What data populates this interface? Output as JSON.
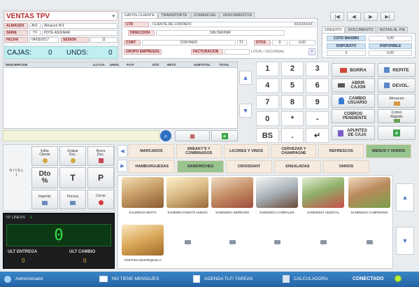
{
  "header": {
    "title": "VENTAS TPV",
    "almacen_label": "ALMACEN",
    "almacen_code": "A01",
    "almacen_name": "Almacen Nº1",
    "serie_label": "SERIE",
    "serie_code": "TV",
    "serie_name": "PDTE.ASIGNAR",
    "fecha_label": "FECHA",
    "fecha_value": "04/05/2017",
    "sesion_label": "SESION",
    "sesion_value": "11",
    "cajas_label": "CAJAS:",
    "cajas_value": "0",
    "unds_label": "UNDS:",
    "unds_value": "0"
  },
  "client_tabs": [
    "DATOS CLIENTE",
    "TRANSPORTE",
    "COMERCIAL",
    "VENCIMIENTOS"
  ],
  "client": {
    "ctd_label": "CTD",
    "ctd_value": "CLIENTE DE CONTADO",
    "ctd_extra": "XXXXXXXX",
    "direccion_label": "DIRECCION",
    "direccion_value": "SIN DEFINIR",
    "cobt_label": "COBT",
    "cobt_value": "CONTADO",
    "t1": "T1",
    "dtos_label": "DTOS",
    "dtos_v1": "0",
    "dtos_v2": "0,00",
    "grupo_label": "GRUPO EMPRESAS",
    "facturacion_label": "FACTURACION",
    "local_label": "LOCAL / SUCURSAL"
  },
  "nav_buttons": [
    "first-icon",
    "prev-icon",
    "next-icon",
    "last-icon"
  ],
  "credit_tabs": [
    "CREDITO",
    "DOCUMENTO",
    "NOTAS AL PIE"
  ],
  "credit": {
    "coto_label": "COTO MAXIMO",
    "coto_value": "0,00",
    "col1_label": "DISPUESTO",
    "col1_value": "0",
    "col2_label": "DISPONIBLE",
    "col2_value": "0,00"
  },
  "lines_table": {
    "columns": [
      "DESCRIPCION",
      "U.CAJA",
      "UNDS.",
      "P.V.P",
      "DTO",
      "NETO",
      "SUBTOTAL",
      "TOTAL"
    ]
  },
  "keypad": [
    "1",
    "2",
    "3",
    "4",
    "5",
    "6",
    "7",
    "8",
    "9",
    "0",
    "*",
    "-",
    "BS",
    ".",
    "↵"
  ],
  "actions": {
    "borra": "BORRA",
    "repite": "REPITE",
    "abrir_cajon": "ABRIR CAJON",
    "devol": "DEVOL.",
    "cambio_usuario": "CAMBIO USUARIO",
    "almacen": "Almacen",
    "cobros_pendiente": "COBROS PENDIENTE",
    "cobro_rapido": "Cobro Rapido",
    "apuntes_caja": "APUNTES DE CAJA"
  },
  "left_tools": {
    "nivel_label": "NIVEL",
    "nivel_value": "1",
    "edita_cliente": "Edita Cliente",
    "grabar_doc": "Grabar Doc.",
    "borra_doc": "Borra Doc.",
    "dto": "Dto %",
    "t": "T",
    "p": "P",
    "imprimir": "Imprimir",
    "precios": "Precios",
    "cerrar": "Cerrar"
  },
  "display": {
    "linea_label": "Nº LINEAS",
    "linea_value": "0",
    "big_value": "0",
    "ult_entrega_label": "ULT ENTREGA",
    "ult_entrega_value": "0",
    "ult_cambio_label": "ULT CAMBIO",
    "ult_cambio_value": "0"
  },
  "categories_row1": [
    {
      "label": "MARCADOS",
      "selected": false
    },
    {
      "label": "SNEAKY'S Y COMBINADOS",
      "selected": false
    },
    {
      "label": "LICORES Y VINOS",
      "selected": false
    },
    {
      "label": "CERVEZAS Y CHAMPAGNE",
      "selected": false
    },
    {
      "label": "REFRESCOS",
      "selected": false
    },
    {
      "label": "MENUS Y VARIOS",
      "selected": true
    }
  ],
  "categories_row2": [
    {
      "label": "HAMBURGUESAS",
      "selected": false
    },
    {
      "label": "SANDWICHES",
      "selected": true
    },
    {
      "label": "CROISSANT",
      "selected": false
    },
    {
      "label": "ENSALADAS",
      "selected": false
    },
    {
      "label": "VARIOS",
      "selected": false
    }
  ],
  "products": [
    {
      "name": "SALDWICH MIXTO",
      "color": "#c9a06a"
    },
    {
      "name": "SANDWICH MIXTO HUEVO",
      "color": "#d8b884"
    },
    {
      "name": "SANDWICH SERRANO",
      "color": "#c48f66"
    },
    {
      "name": "SANDWICH CABRALES",
      "color": "#a8b2b8"
    },
    {
      "name": "SANDWICH VEGETAL",
      "color": "#8fb06a"
    },
    {
      "name": "SANDWICH CAMPESINO",
      "color": "#b98a5e"
    },
    {
      "name": "TOSTADA MANTEQUILLA",
      "color": "#d9a85a"
    }
  ],
  "status_bar": {
    "user": "Administrador",
    "mensajes": "NO TIENE MENSAJES",
    "agenda": "AGENDA TLF/ TAREAS",
    "calculadora": "CALCULADORA",
    "conectado": "CONECTADO"
  },
  "colors": {
    "accent_red": "#b02a2a",
    "cyan_field": "#bfeff0",
    "selected_green": "#98c48f",
    "status_bar": "#2f75b5",
    "display_green": "#2ecc40"
  }
}
